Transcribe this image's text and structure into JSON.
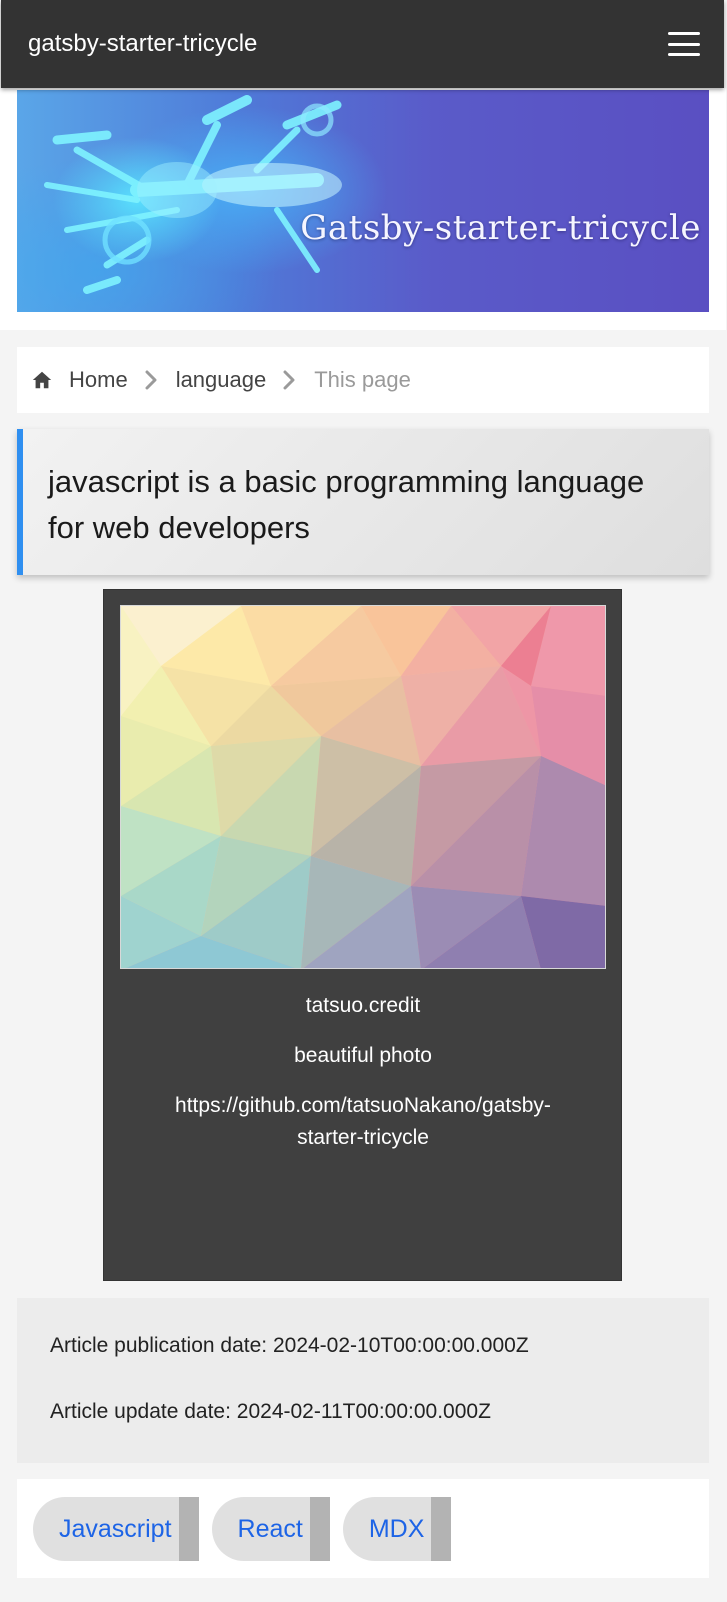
{
  "header": {
    "site_title": "gatsby-starter-tricycle",
    "menu_icon": "hamburger-menu-icon"
  },
  "hero": {
    "title_text": "Gatsby-starter-tricycle",
    "image_icon": "tricycle-photo"
  },
  "breadcrumb": {
    "home_icon": "home-icon",
    "separator_icon": "chevron-right-icon",
    "items": [
      {
        "label": "Home"
      },
      {
        "label": "language"
      },
      {
        "label": "This page"
      }
    ]
  },
  "article": {
    "title": "javascript is a basic programming language for web developers",
    "accent_color": "#2f8ff0"
  },
  "photo": {
    "credit": "tatsuo.credit",
    "description": "beautiful photo",
    "source_url": "https://github.com/tatsuoNakano/gatsby-starter-tricycle"
  },
  "dates": {
    "published": "Article publication date: 2024-02-10T00:00:00.000Z",
    "updated": "Article update date: 2024-02-11T00:00:00.000Z"
  },
  "tags": [
    {
      "label": "Javascript"
    },
    {
      "label": "React"
    },
    {
      "label": "MDX"
    }
  ],
  "colors": {
    "header_bg": "#333333",
    "tag_text": "#1d64e6",
    "card_bg": "#404040"
  }
}
